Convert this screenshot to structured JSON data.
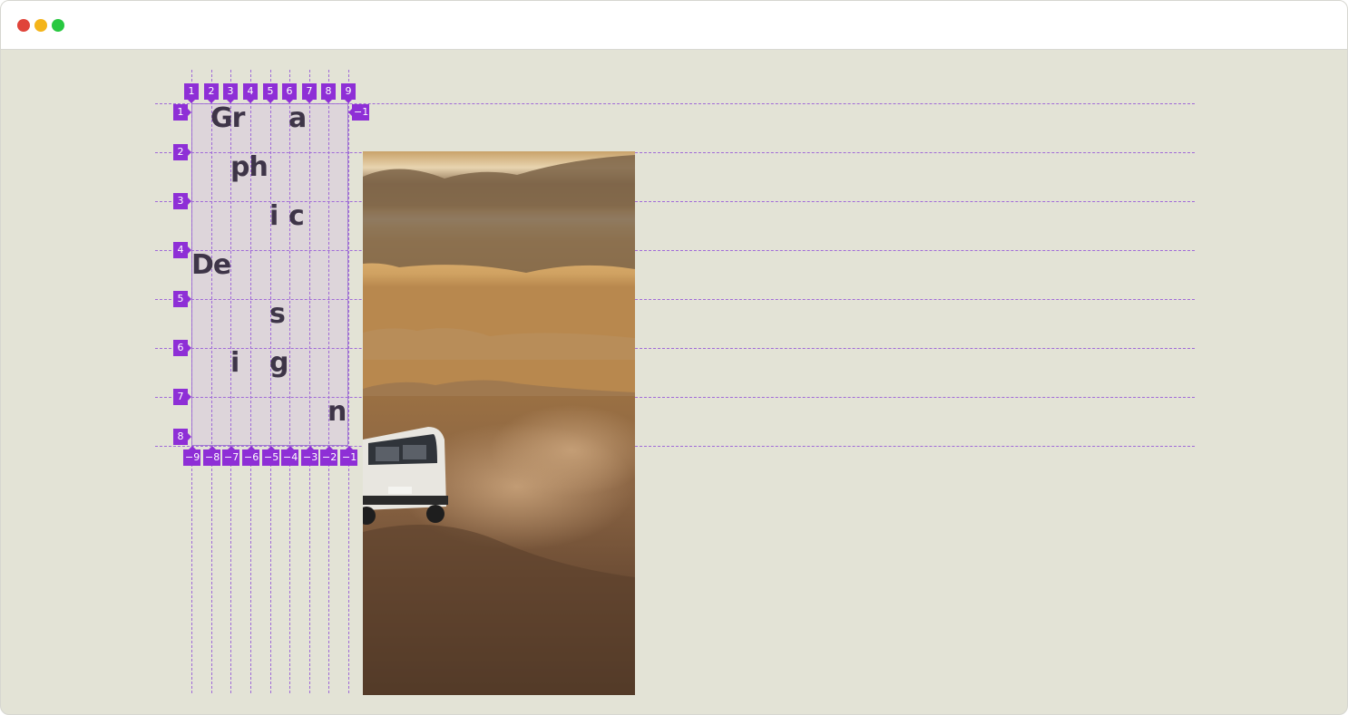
{
  "window": {
    "controls": [
      "close",
      "minimize",
      "zoom"
    ],
    "colors": {
      "close": "#e0443a",
      "minimize": "#f4b41a",
      "zoom": "#28c840"
    }
  },
  "grid": {
    "column_labels_top": [
      "1",
      "2",
      "3",
      "4",
      "5",
      "6",
      "7",
      "8",
      "9"
    ],
    "column_labels_bottom": [
      "−9",
      "−8",
      "−7",
      "−6",
      "−5",
      "−4",
      "−3",
      "−2",
      "−1"
    ],
    "row_labels_left": [
      "1",
      "2",
      "3",
      "4",
      "5",
      "6",
      "7",
      "8"
    ],
    "row_label_right": "−1",
    "overlay_color": "#8e2fd6"
  },
  "glyphs": {
    "gr": "Gr",
    "a": "a",
    "ph": "ph",
    "i1": "i",
    "c": "c",
    "de": "De",
    "s": "s",
    "i2": "i",
    "g": "g",
    "n": "n"
  },
  "photo": {
    "subject-icon": "desert-road-van-icon"
  }
}
